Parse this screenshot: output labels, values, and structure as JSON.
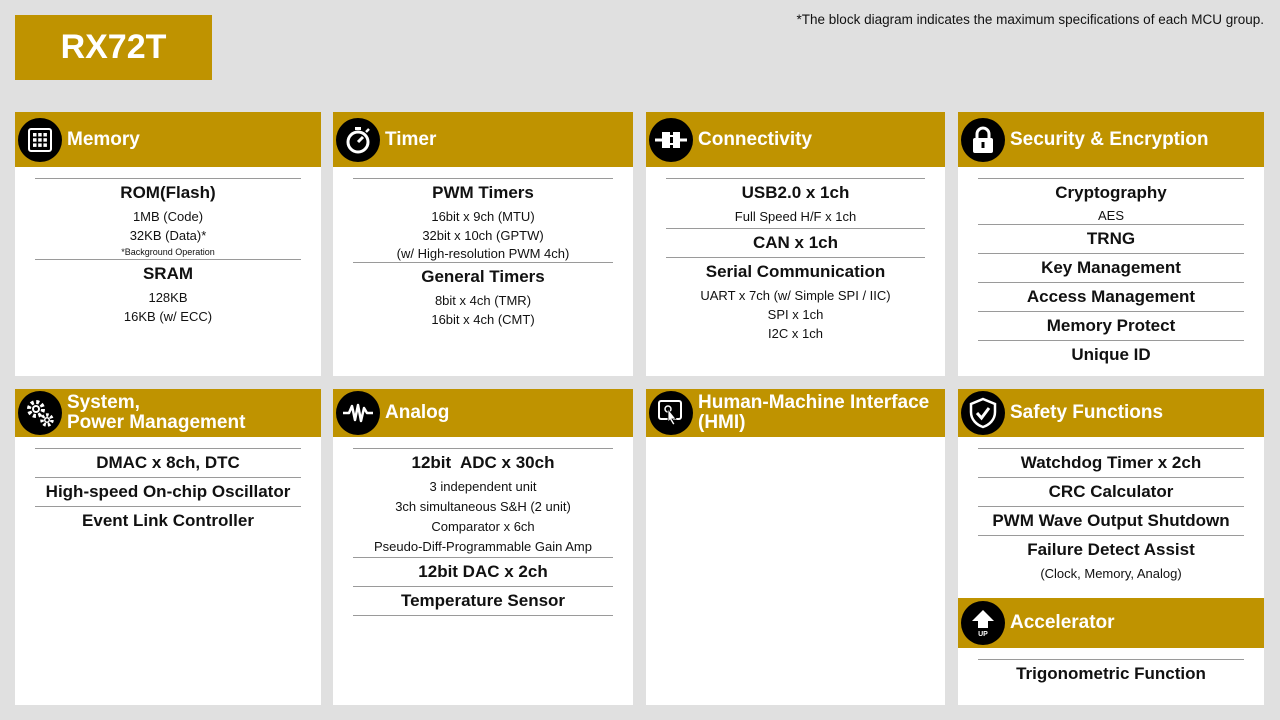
{
  "title": "RX72T",
  "note": "*The block diagram indicates the maximum specifications of each MCU group.",
  "memory": {
    "header": "Memory",
    "icon": "memory-chip-icon",
    "rom_title": "ROM(Flash)",
    "rom_code": "1MB (Code)",
    "rom_data": "32KB (Data)*",
    "rom_note": "*Background Operation",
    "sram_title": "SRAM",
    "sram_size": "128KB",
    "sram_ecc": "16KB (w/ ECC)"
  },
  "timer": {
    "header": "Timer",
    "icon": "stopwatch-icon",
    "pwm_title": "PWM Timers",
    "pwm_1": "16bit x 9ch (MTU)",
    "pwm_2": "32bit x 10ch (GPTW)",
    "pwm_3": "(w/ High-resolution PWM 4ch)",
    "gen_title": "General Timers",
    "gen_1": "8bit x 4ch (TMR)",
    "gen_2": "16bit x 4ch (CMT)"
  },
  "connectivity": {
    "header": "Connectivity",
    "icon": "plug-icon",
    "usb_title": "USB2.0 x 1ch",
    "usb_sub": "Full Speed H/F x 1ch",
    "can_title": "CAN x 1ch",
    "serial_title": "Serial Communication",
    "serial_1": "UART x 7ch (w/ Simple SPI / IIC)",
    "serial_2": "SPI x 1ch",
    "serial_3": "I2C x 1ch"
  },
  "security": {
    "header": "Security & Encryption",
    "icon": "padlock-icon",
    "crypto_title": "Cryptography",
    "crypto_sub": "AES",
    "trng": "TRNG",
    "key_mgmt": "Key Management",
    "access_mgmt": "Access Management",
    "mem_protect": "Memory Protect",
    "unique_id": "Unique ID"
  },
  "system": {
    "header_1": "System,",
    "header_2": "Power Management",
    "icon": "gears-icon",
    "dmac": "DMAC x 8ch, DTC",
    "osc": "High-speed On-chip Oscillator",
    "elc": "Event Link Controller"
  },
  "analog": {
    "header": "Analog",
    "icon": "waveform-icon",
    "adc_title": "12bit  ADC x 30ch",
    "adc_1": "3 independent unit",
    "adc_2": "3ch simultaneous S&H (2 unit)",
    "adc_3": "Comparator x 6ch",
    "adc_4": "Pseudo-Diff-Programmable Gain Amp",
    "dac": "12bit DAC x 2ch",
    "temp": "Temperature Sensor"
  },
  "hmi": {
    "header_1": "Human-Machine Interface",
    "header_2": "(HMI)",
    "icon": "touch-screen-icon"
  },
  "safety": {
    "header": "Safety Functions",
    "icon": "shield-check-icon",
    "wdt": "Watchdog Timer x 2ch",
    "crc": "CRC Calculator",
    "pwm_shutdown": "PWM Wave Output Shutdown",
    "failure": "Failure Detect Assist",
    "failure_sub": "(Clock, Memory, Analog)"
  },
  "accelerator": {
    "header": "Accelerator",
    "icon": "up-arrow-icon",
    "icon_text": "UP",
    "trig": "Trigonometric Function"
  },
  "colors": {
    "accent": "#bf9300",
    "background": "#e0e0e0",
    "panel": "#ffffff"
  }
}
